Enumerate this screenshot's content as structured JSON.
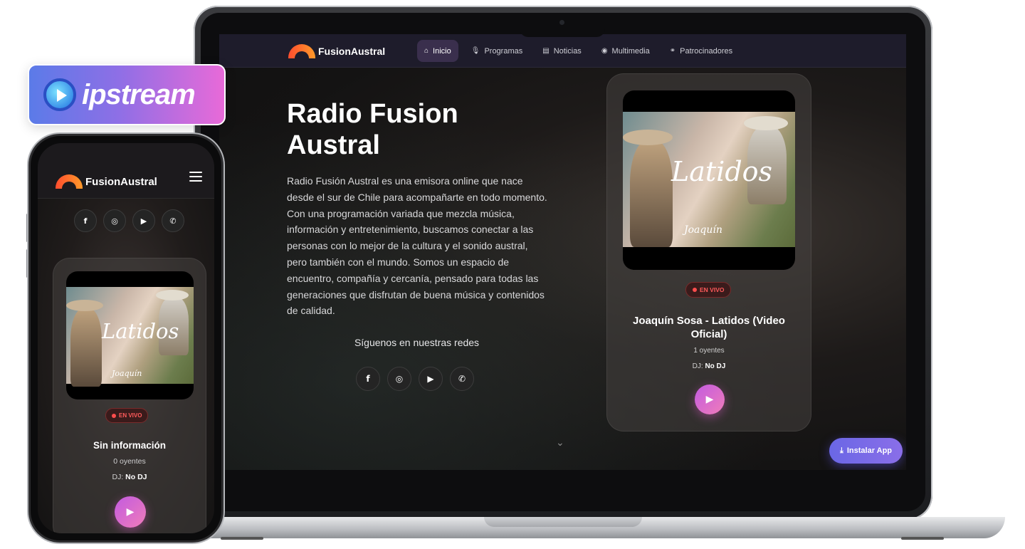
{
  "brand": {
    "logo_text": "FusionAustral",
    "badge_text": "ipstream",
    "accent_gradient": [
      "#c25be0",
      "#f07cba"
    ],
    "badge_gradient": [
      "#5b7be8",
      "#e86ad8"
    ]
  },
  "nav": {
    "items": [
      {
        "label": "Inicio",
        "icon": "home-icon",
        "glyph": "⌂",
        "active": true
      },
      {
        "label": "Programas",
        "icon": "microphone-icon",
        "glyph": "🎙",
        "active": false
      },
      {
        "label": "Noticias",
        "icon": "newspaper-icon",
        "glyph": "▤",
        "active": false
      },
      {
        "label": "Multimedia",
        "icon": "play-circle-icon",
        "glyph": "◉",
        "active": false
      },
      {
        "label": "Patrocinadores",
        "icon": "handshake-icon",
        "glyph": "⚭",
        "active": false
      }
    ]
  },
  "hero": {
    "title": "Radio Fusion Austral",
    "description": "Radio Fusión Austral es una emisora online que nace desde el sur de Chile para acompañarte en todo momento. Con una programación variada que mezcla música, información y entretenimiento, buscamos conectar a las personas con lo mejor de la cultura y el sonido austral, pero también con el mundo. Somos un espacio de encuentro, compañía y cercanía, pensado para todas las generaciones que disfrutan de buena música y contenidos de calidad.",
    "follow_label": "Síguenos en nuestras redes"
  },
  "socials": [
    {
      "name": "facebook-icon",
      "glyph": "f"
    },
    {
      "name": "instagram-icon",
      "glyph": "◎"
    },
    {
      "name": "youtube-icon",
      "glyph": "▶"
    },
    {
      "name": "whatsapp-icon",
      "glyph": "✆"
    }
  ],
  "desktop_player": {
    "cover_script": "Latidos",
    "cover_brand": "Joaquín",
    "live_label": "EN VIVO",
    "song": "Joaquín Sosa - Latidos (Video Oficial)",
    "listeners": "1 oyentes",
    "dj_label": "DJ:",
    "dj_name": "No DJ"
  },
  "mobile_player": {
    "cover_script": "Latidos",
    "cover_brand": "Joaquín",
    "live_label": "EN VIVO",
    "song": "Sin información",
    "listeners": "0 oyentes",
    "dj_label": "DJ:",
    "dj_name": "No DJ"
  },
  "install_button": {
    "label": "Instalar App",
    "icon": "download-icon",
    "glyph": "⤓"
  },
  "scroll_hint": {
    "icon": "chevron-down-icon",
    "glyph": "⌄"
  }
}
